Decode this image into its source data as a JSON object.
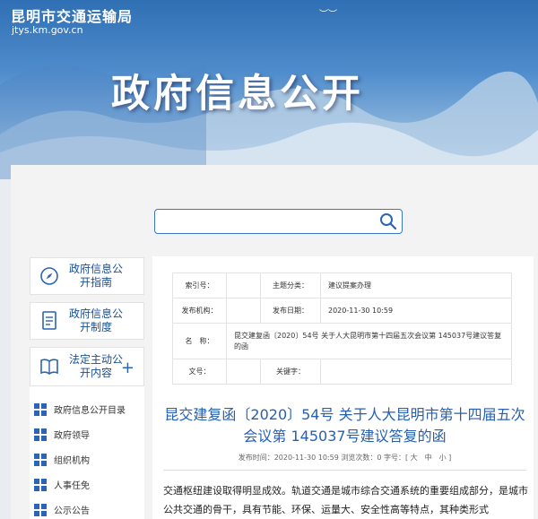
{
  "header": {
    "site_name": "昆明市交通运输局",
    "site_url": "jtys.km.gov.cn",
    "banner_title": "政府信息公开"
  },
  "search": {
    "placeholder": "",
    "value": ""
  },
  "sidebar": {
    "cards": [
      {
        "label": "政府信息公开指南",
        "icon": "compass-icon"
      },
      {
        "label": "政府信息公开制度",
        "icon": "document-icon"
      },
      {
        "label": "法定主动公开内容",
        "icon": "book-icon",
        "expand_symbol": "+"
      }
    ],
    "items": [
      {
        "label": "政府信息公开目录"
      },
      {
        "label": "政府领导"
      },
      {
        "label": "组织机构"
      },
      {
        "label": "人事任免"
      },
      {
        "label": "公示公告"
      }
    ]
  },
  "meta_table": {
    "index_label": "索引号：",
    "index_value": "",
    "topic_label": "主题分类：",
    "topic_value": "建议提案办理",
    "publisher_label": "发布机构：",
    "publisher_value": "",
    "date_label": "发布日期：",
    "date_value": "2020-11-30 10:59",
    "name_label": "名　称：",
    "name_value": "昆交建复函〔2020〕54号 关于人大昆明市第十四届五次会议第 145037号建议答复的函",
    "docno_label": "文号：",
    "docno_value": "",
    "keyword_label": "关键字：",
    "keyword_value": ""
  },
  "article": {
    "title": "昆交建复函〔2020〕54号 关于人大昆明市第十四届五次会议第 145037号建议答复的函",
    "publish_info": "发布时间：2020-11-30 10:59 浏览次数：0 字号：[ 大　中　小 ]",
    "body": "交通枢纽建设取得明显成效。轨道交通是城市综合交通系统的重要组成部分，是城市公共交通的骨干，具有节能、环保、运量大、安全性高等特点，其种类形式"
  },
  "colors": {
    "accent": "#2b64b4",
    "title": "#2760b0",
    "banner_top": "#2f6fb3"
  }
}
